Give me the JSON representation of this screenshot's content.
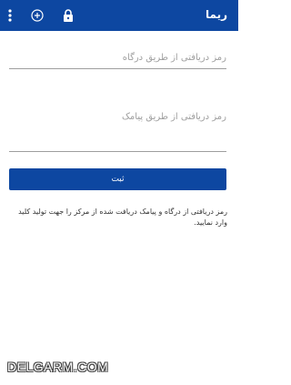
{
  "appbar": {
    "title": "ریما",
    "background": "#0d47a1",
    "icons": [
      "more-vert-icon",
      "add-circle-icon",
      "lock-icon"
    ]
  },
  "form": {
    "gateway_code_placeholder": "رمز دریافتی از طریق درگاه",
    "sms_code_placeholder": "رمز دریافتی از طریق پیامک",
    "submit_label": "ثبت"
  },
  "info_text": "رمز دریافتی از درگاه و پیامک دریافت شده از مرکز را جهت تولید کلید وارد نمایید.",
  "watermark": "DELGARM.COM"
}
